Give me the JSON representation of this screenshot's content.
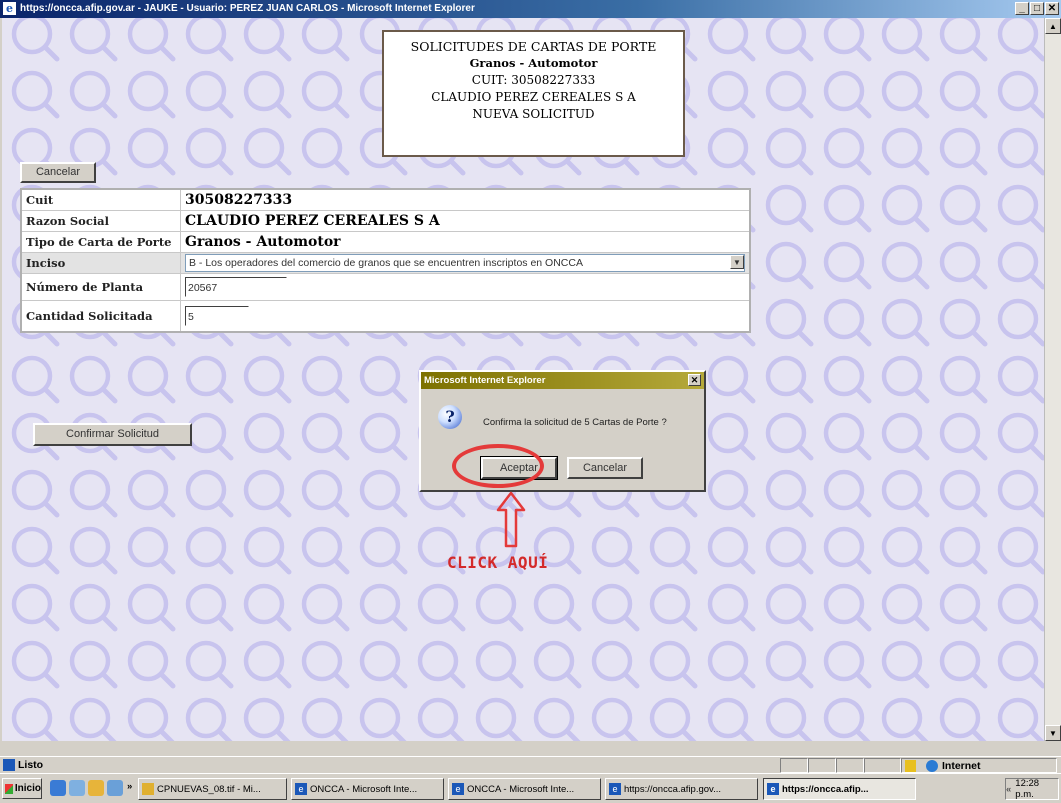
{
  "window": {
    "title": "https://oncca.afip.gov.ar - JAUKE - Usuario: PEREZ JUAN CARLOS - Microsoft Internet Explorer",
    "minimize": "_",
    "maximize": "□",
    "close": "✕"
  },
  "header": {
    "title": "SOLICITUDES DE CARTAS DE PORTE",
    "subtitle": "Granos - Automotor",
    "cuit": "CUIT: 30508227333",
    "company": "CLAUDIO PEREZ CEREALES S A",
    "mode": "NUEVA SOLICITUD"
  },
  "buttons": {
    "cancel": "Cancelar",
    "confirm": "Confirmar Solicitud"
  },
  "form": {
    "cuit_label": "Cuit",
    "cuit_value": "30508227333",
    "razon_label": "Razon Social",
    "razon_value": "CLAUDIO PEREZ CEREALES S A",
    "tipo_label": "Tipo de Carta de Porte",
    "tipo_value": "Granos - Automotor",
    "inciso_label": "Inciso",
    "inciso_value": "B - Los operadores del comercio de granos que se encuentren inscriptos en ONCCA",
    "planta_label": "Número de Planta",
    "planta_value": "20567",
    "cantidad_label": "Cantidad Solicitada",
    "cantidad_value": "5"
  },
  "dialog": {
    "title": "Microsoft Internet Explorer",
    "message": "Confirma la solicitud de 5 Cartas de Porte ?",
    "accept": "Aceptar",
    "cancel": "Cancelar",
    "icon": "question-icon"
  },
  "annotation": {
    "text": "CLICK AQUÍ",
    "color": "#e43a3a"
  },
  "status": {
    "left": "Listo",
    "zone": "Internet"
  },
  "taskbar": {
    "start": "Inicio",
    "tasks": [
      "CPNUEVAS_08.tif - Mi...",
      "ONCCA - Microsoft Inte...",
      "ONCCA - Microsoft Inte...",
      "https://oncca.afip.gov...",
      "https://oncca.afip..."
    ],
    "clock": "12:28 p.m."
  },
  "colors": {
    "pattern_bg": "#e6e4f3",
    "pattern_ring": "#c8c4ee",
    "title_bar": "#0a246a"
  }
}
